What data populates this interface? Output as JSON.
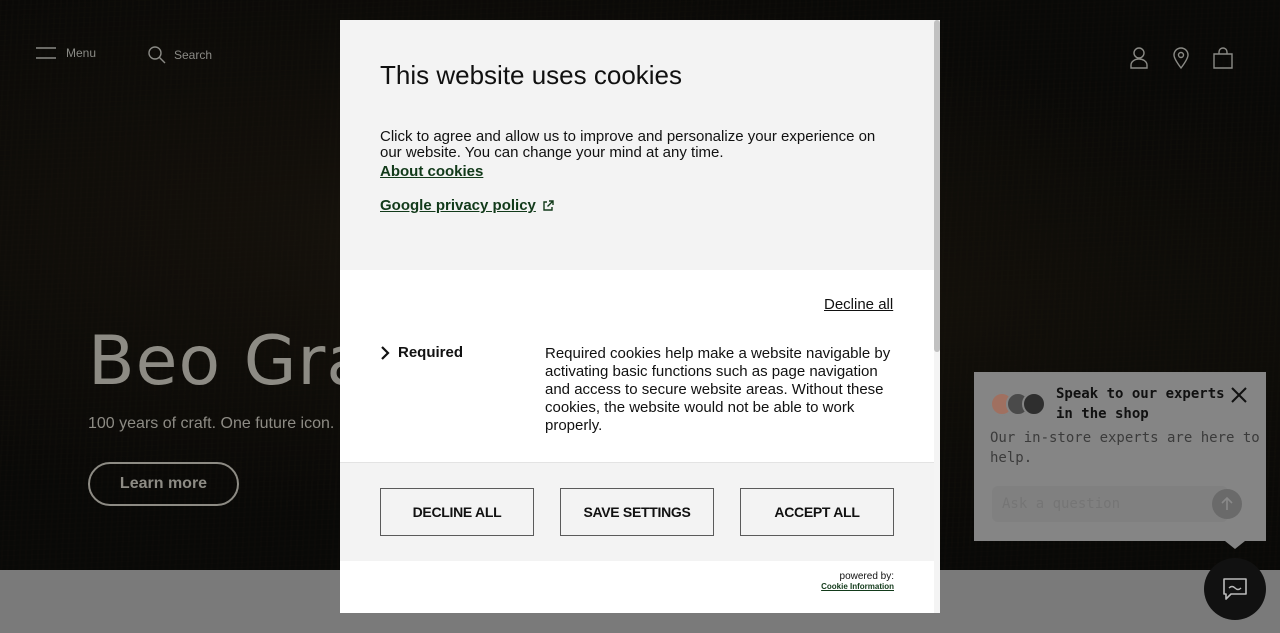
{
  "nav": {
    "menu_label": "Menu",
    "search_label": "Search"
  },
  "hero": {
    "title": "Beo Grace",
    "subtitle": "100 years of craft. One future icon.",
    "cta_label": "Learn more"
  },
  "cookie_modal": {
    "title": "This website uses cookies",
    "intro": "Click to agree and allow us to improve and personalize your experience on our website. You can change your mind at any time.",
    "about_link": "About cookies",
    "privacy_link": "Google privacy policy",
    "decline_link": "Decline all",
    "required_label": "Required",
    "required_description": "Required cookies help make a website navigable by activating basic functions such as page navigation and access to secure website areas. Without these cookies, the website would not be able to work properly.",
    "buttons": {
      "decline_all": "DECLINE ALL",
      "save_settings": "SAVE SETTINGS",
      "accept_all": "ACCEPT ALL"
    },
    "powered_by": "powered by:",
    "powered_by_link": "Cookie Information"
  },
  "chat": {
    "title": "Speak to our experts in the shop",
    "description": "Our in-store experts are here to help.",
    "input_placeholder": "Ask a question"
  },
  "colors": {
    "link_green": "#123a1a",
    "modal_header_bg": "#f3f3f3",
    "overlay": "rgba(0,0,0,0.55)"
  }
}
